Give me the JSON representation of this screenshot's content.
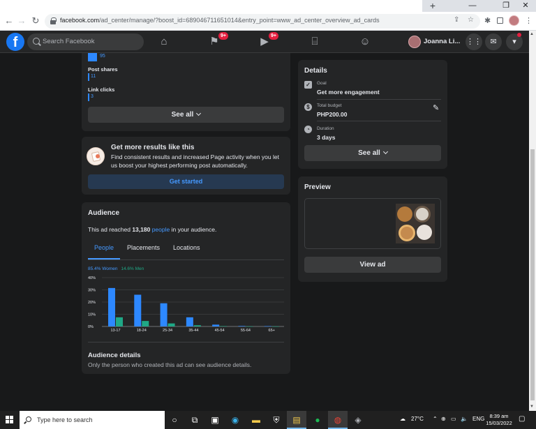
{
  "browser": {
    "url_host": "facebook.com",
    "url_path": "/ad_center/manage/?boost_id=689046711651014&entry_point=www_ad_center_overview_ad_cards",
    "new_tab": "+",
    "win_minimize": "—",
    "win_restore": "❐",
    "win_close": "✕"
  },
  "fbnav": {
    "logo": "f",
    "search_placeholder": "Search Facebook",
    "flag_badge": "9+",
    "video_badge": "9+",
    "profile_name": "Joanna Li..."
  },
  "results": {
    "top_value": "95",
    "metrics": [
      {
        "label": "Post shares",
        "value": "11"
      },
      {
        "label": "Link clicks",
        "value": "3"
      }
    ],
    "see_all": "See all"
  },
  "promo": {
    "title": "Get more results like this",
    "body": "Find consistent results and increased Page activity when you let us boost your highest performing post automatically.",
    "button": "Get started"
  },
  "audience": {
    "title": "Audience",
    "reach_prefix": "This ad reached ",
    "reach_count": "13,180",
    "reach_link": "people",
    "reach_suffix": " in your audience.",
    "tabs": [
      "People",
      "Placements",
      "Locations"
    ],
    "women_label": "85.4% Women",
    "men_label": "14.6% Men",
    "details_title": "Audience details",
    "details_body": "Only the person who created this ad can see audience details."
  },
  "details": {
    "title": "Details",
    "goal_label": "Goal",
    "goal_value": "Get more engagement",
    "budget_label": "Total budget",
    "budget_value": "PHP200.00",
    "duration_label": "Duration",
    "duration_value": "3 days",
    "see_all": "See all"
  },
  "preview": {
    "title": "Preview",
    "button": "View ad"
  },
  "chart_data": {
    "type": "bar",
    "categories": [
      "13-17",
      "18-24",
      "25-34",
      "35-44",
      "45-54",
      "55-64",
      "65+"
    ],
    "series": [
      {
        "name": "85.4% Women",
        "values": [
          31.5,
          26,
          19,
          7.5,
          1.5,
          0.4,
          0.3
        ]
      },
      {
        "name": "14.6% Men",
        "values": [
          7.5,
          4.5,
          2.5,
          1,
          0.3,
          0.1,
          0.1
        ]
      }
    ],
    "yticks": [
      "0%",
      "10%",
      "20%",
      "30%",
      "40%"
    ],
    "ylim": [
      0,
      40
    ],
    "grid": true,
    "colors": {
      "women": "#2d88ff",
      "men": "#1fa886"
    }
  },
  "taskbar": {
    "search_text": "Type here to search",
    "weather": "27°C",
    "lang": "ENG",
    "time": "8:39 am",
    "date": "15/03/2022"
  }
}
